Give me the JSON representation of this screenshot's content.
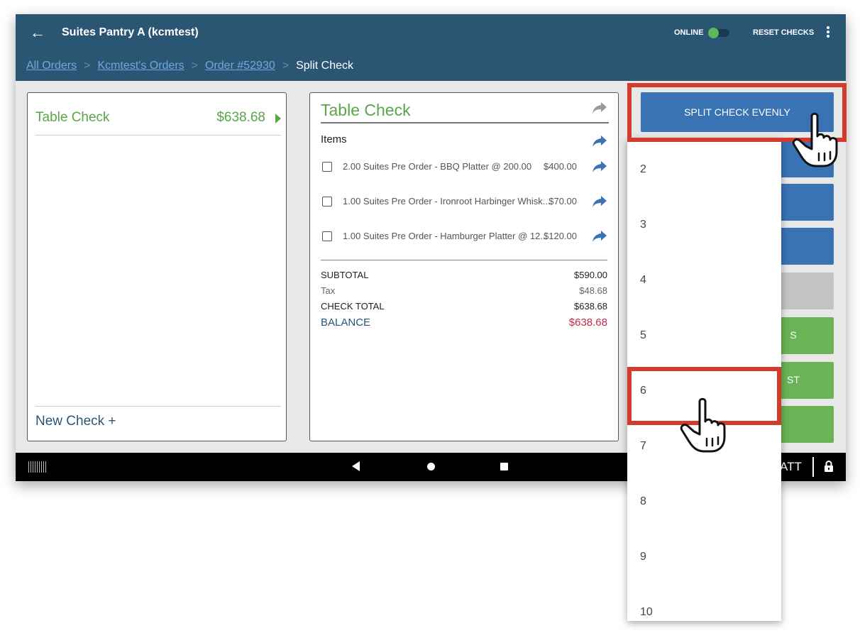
{
  "header": {
    "back_icon": "arrow-left-icon",
    "title": "Suites Pantry A (kcmtest)",
    "online_label": "ONLINE",
    "online_toggle_on": true,
    "reset_checks": "RESET CHECKS",
    "more_icon": "more-vertical-icon"
  },
  "breadcrumb": {
    "items": [
      "All Orders",
      "Kcmtest's Orders",
      "Order #52930"
    ],
    "current": "Split Check",
    "separator": ">"
  },
  "checks_panel": {
    "check_name": "Table Check",
    "check_amount": "$638.68",
    "new_check": "New Check +"
  },
  "detail_panel": {
    "title": "Table Check",
    "items_label": "Items",
    "items": [
      {
        "desc": "2.00 Suites Pre Order - BBQ Platter @  200.00",
        "price": "$400.00"
      },
      {
        "desc": "1.00 Suites Pre Order - Ironroot Harbinger Whisk...",
        "price": "$70.00"
      },
      {
        "desc": "1.00 Suites Pre Order - Hamburger Platter @  12...",
        "price": "$120.00"
      }
    ],
    "totals": {
      "subtotal_label": "SUBTOTAL",
      "subtotal_value": "$590.00",
      "tax_label": "Tax",
      "tax_value": "$48.68",
      "check_total_label": "CHECK TOTAL",
      "check_total_value": "$638.68",
      "balance_label": "BALANCE",
      "balance_value": "$638.68"
    }
  },
  "side_actions": {
    "split_evenly": "SPLIT CHECK EVENLY",
    "partial_label_1": "S",
    "partial_label_2": "ST"
  },
  "split_dropdown": {
    "options": [
      "2",
      "3",
      "4",
      "5",
      "6",
      "7",
      "8",
      "9",
      "10"
    ],
    "highlighted": "6"
  },
  "bottom_bar": {
    "user_label": "ATT",
    "lock_icon": "lock-icon"
  },
  "colors": {
    "header": "#2a5674",
    "accent_green": "#5aa548",
    "button_blue": "#3a73b3",
    "button_green": "#6ab356",
    "button_gray": "#c4c4c4",
    "balance_red": "#c0294a",
    "highlight_red": "#d33b2d",
    "share_icon": "#3a73b3"
  }
}
